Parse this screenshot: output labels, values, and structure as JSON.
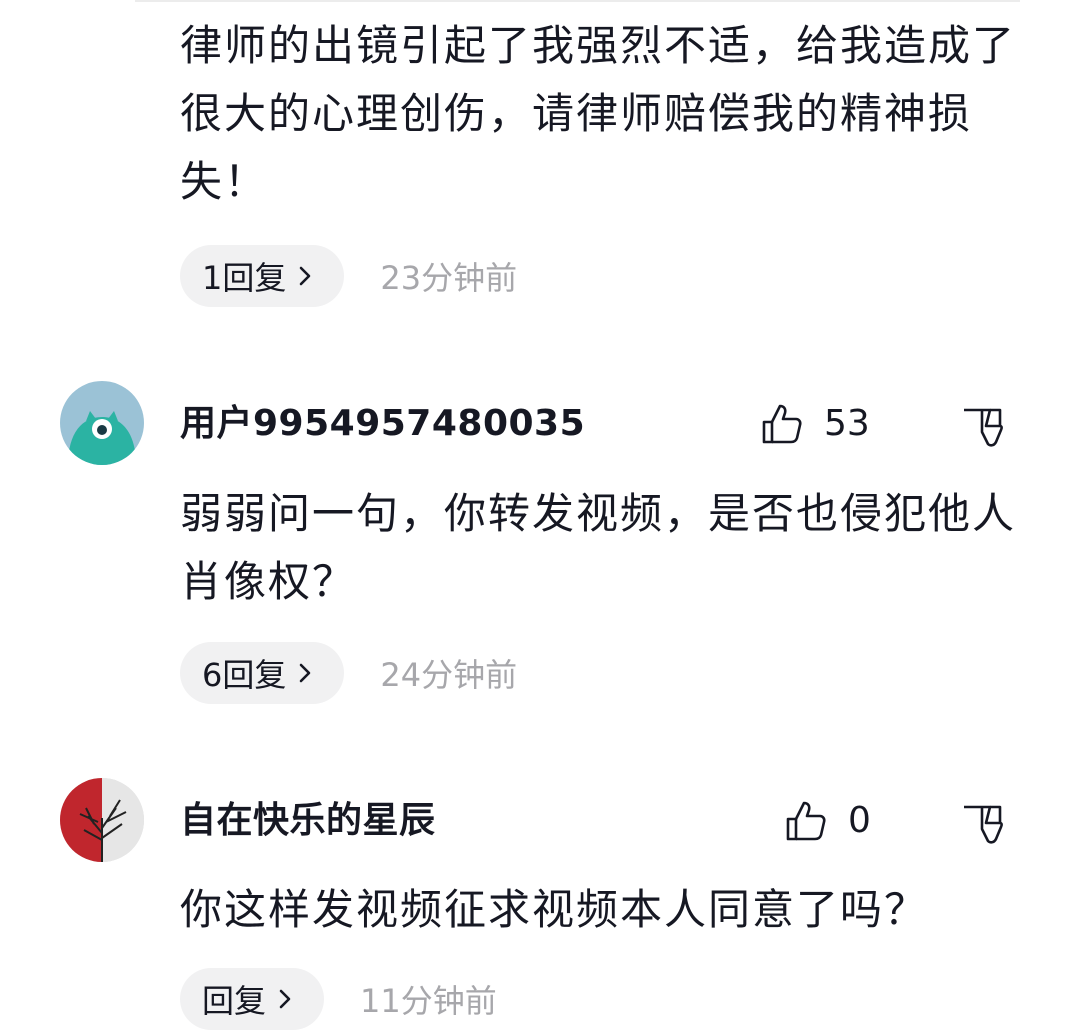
{
  "comments": [
    {
      "username": "",
      "text": "律师的出镜引起了我强烈不适，给我造成了很大的心理创伤，请律师赔偿我的精神损失！",
      "reply_label": "1回复",
      "timestamp": "23分钟前"
    },
    {
      "username": "用户9954957480035",
      "avatar": "teal-monster-avatar",
      "likes": "53",
      "text": "弱弱问一句，你转发视频，是否也侵犯他人肖像权？",
      "reply_label": "6回复",
      "timestamp": "24分钟前"
    },
    {
      "username": "自在快乐的星辰",
      "avatar": "red-tree-avatar",
      "likes": "0",
      "text": "你这样发视频征求视频本人同意了吗？",
      "reply_label": "回复",
      "timestamp": "11分钟前"
    }
  ],
  "icons": {
    "like": "thumbs-up-outline-icon",
    "dislike": "thumbs-down-outline-icon",
    "chevron": "chevron-right-icon"
  },
  "colors": {
    "text": "#161823",
    "muted": "#a7a7ab",
    "pill_bg": "#f1f1f2",
    "avatar_teal": "#2bb3a3"
  }
}
